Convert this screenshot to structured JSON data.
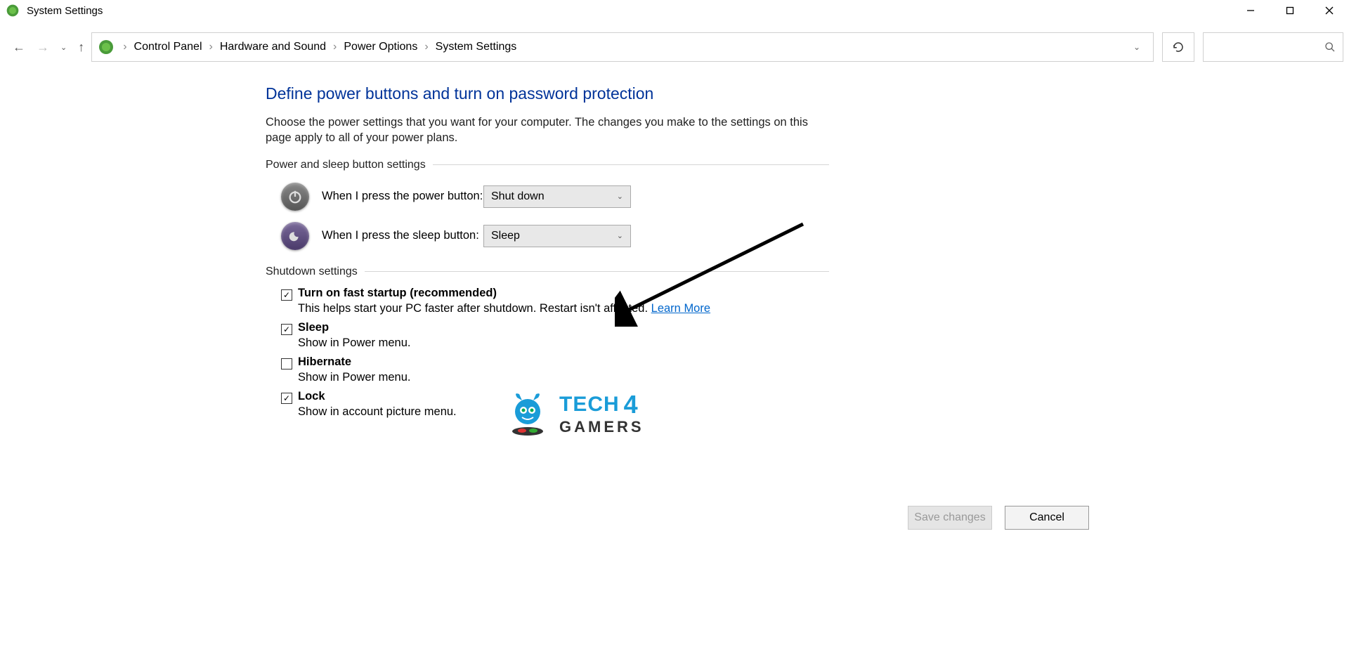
{
  "window": {
    "title": "System Settings"
  },
  "breadcrumbs": {
    "root": "Control Panel",
    "level1": "Hardware and Sound",
    "level2": "Power Options",
    "level3": "System Settings"
  },
  "page": {
    "heading": "Define power buttons and turn on password protection",
    "description": "Choose the power settings that you want for your computer. The changes you make to the settings on this page apply to all of your power plans."
  },
  "section1": {
    "title": "Power and sleep button settings",
    "power_button_label": "When I press the power button:",
    "power_button_value": "Shut down",
    "sleep_button_label": "When I press the sleep button:",
    "sleep_button_value": "Sleep"
  },
  "section2": {
    "title": "Shutdown settings",
    "items": [
      {
        "label": "Turn on fast startup (recommended)",
        "desc": "This helps start your PC faster after shutdown. Restart isn't affected. ",
        "link": "Learn More",
        "checked": true
      },
      {
        "label": "Sleep",
        "desc": "Show in Power menu.",
        "checked": true
      },
      {
        "label": "Hibernate",
        "desc": "Show in Power menu.",
        "checked": false
      },
      {
        "label": "Lock",
        "desc": "Show in account picture menu.",
        "checked": true
      }
    ]
  },
  "buttons": {
    "save": "Save changes",
    "cancel": "Cancel"
  },
  "watermark": {
    "line1": "TECH",
    "four": "4",
    "line2": "GAMERS"
  }
}
